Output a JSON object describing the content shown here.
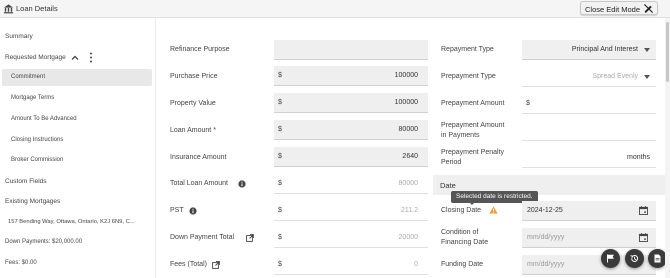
{
  "window": {
    "title": "Loan Details",
    "exit_button": "Close Edit Mode"
  },
  "sidebar": {
    "summary": "Summary",
    "requested_mortgage": "Requested Mortgage",
    "sub_items": [
      "Commitment",
      "Mortgage Terms",
      "Amount To Be Advanced",
      "Closing Instructions",
      "Broker Commission"
    ],
    "custom_fields": "Custom Fields",
    "existing_mortgages": "Existing Mortgages",
    "address": "157 Bending Way, Ottawa, Ontario, K2J 6N9, C...",
    "down_payments": "Down Payments: $20,000.00",
    "fees": "Fees: $0.00"
  },
  "main": {
    "refinance_purpose": {
      "label": "Refinance Purpose",
      "value": ""
    },
    "purchase_price": {
      "label": "Purchase Price",
      "currency": "$",
      "value": "100000"
    },
    "property_value": {
      "label": "Property Value",
      "currency": "$",
      "value": "100000"
    },
    "loan_amount": {
      "label": "Loan Amount *",
      "currency": "$",
      "value": "80000"
    },
    "insurance_amount": {
      "label": "Insurance Amount",
      "currency": "$",
      "value": "2640"
    },
    "total_loan_amount": {
      "label": "Total Loan Amount",
      "currency": "$",
      "value": "80000"
    },
    "pst": {
      "label": "PST",
      "currency": "$",
      "value": "211.2"
    },
    "down_payment_total": {
      "label": "Down Payment Total",
      "currency": "$",
      "value": "20000"
    },
    "fees_total": {
      "label": "Fees (Total)",
      "currency": "$",
      "value": "0"
    }
  },
  "right": {
    "repayment_type": {
      "label": "Repayment Type",
      "value": "Principal And Interest"
    },
    "prepayment_type": {
      "label": "Prepayment Type",
      "value": "Spread Evenly"
    },
    "prepayment_amount": {
      "label": "Prepayment Amount",
      "currency": "$"
    },
    "prepayment_amount_in_payments": {
      "label_line1": "Prepayment Amount",
      "label_line2": "in Payments"
    },
    "prepayment_penalty_period": {
      "label_line1": "Prepayment Penalty",
      "label_line2": "Period",
      "unit": "months"
    },
    "date_section": "Date",
    "tooltip": "Selected date is restricted.",
    "closing_date": {
      "label": "Closing Date",
      "value": "2024-12-25"
    },
    "condition_of_financing_date": {
      "label_line1": "Condition of",
      "label_line2": "Financing Date",
      "placeholder": "mm/dd/yyyy"
    },
    "funding_date": {
      "label": "Funding Date",
      "placeholder": "mm/dd/yyyy"
    }
  },
  "colors": {
    "warning": "#e8a33a",
    "fab": "#3a3a3a",
    "tooltip": "#555555"
  },
  "icons": [
    "bank-icon",
    "edit-off-icon",
    "chevron-up-icon",
    "kebab-icon",
    "info-icon",
    "external-link-icon",
    "calendar-icon",
    "warning-icon",
    "flag-icon",
    "history-icon",
    "document-icon"
  ]
}
